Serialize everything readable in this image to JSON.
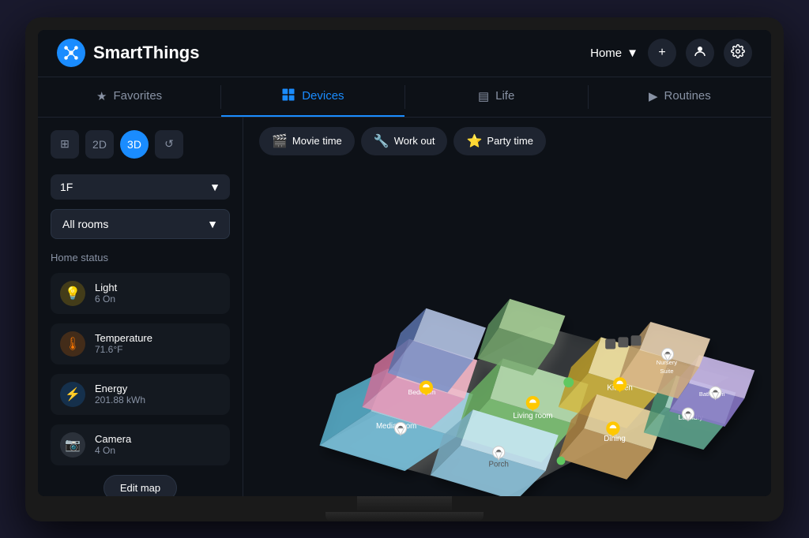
{
  "app": {
    "name": "SmartThings"
  },
  "header": {
    "home_label": "Home",
    "add_button": "+",
    "profile_icon": "person",
    "settings_icon": "gear"
  },
  "nav": {
    "tabs": [
      {
        "id": "favorites",
        "label": "Favorites",
        "icon": "★",
        "active": false
      },
      {
        "id": "devices",
        "label": "Devices",
        "icon": "▦",
        "active": true
      },
      {
        "id": "life",
        "label": "Life",
        "icon": "▤",
        "active": false
      },
      {
        "id": "routines",
        "label": "Routines",
        "icon": "▶",
        "active": false
      }
    ]
  },
  "sidebar": {
    "view_buttons": [
      {
        "id": "grid",
        "label": "⊞",
        "active": false
      },
      {
        "id": "2d",
        "label": "2D",
        "active": false
      },
      {
        "id": "3d",
        "label": "3D",
        "active": true
      },
      {
        "id": "reset",
        "label": "↺",
        "active": false
      }
    ],
    "floor_selector": {
      "label": "1F",
      "icon": "▼"
    },
    "room_selector": {
      "label": "All rooms",
      "icon": "▼"
    },
    "home_status_title": "Home status",
    "status_items": [
      {
        "id": "light",
        "icon": "💡",
        "type": "yellow",
        "label": "Light",
        "value": "6 On"
      },
      {
        "id": "temperature",
        "icon": "🌡",
        "type": "orange",
        "label": "Temperature",
        "value": "71.6°F"
      },
      {
        "id": "energy",
        "icon": "⚡",
        "type": "blue",
        "label": "Energy",
        "value": "201.88 kWh"
      },
      {
        "id": "camera",
        "icon": "📷",
        "type": "gray",
        "label": "Camera",
        "value": "4 On"
      }
    ],
    "edit_map_button": "Edit map"
  },
  "scenes": [
    {
      "id": "movie",
      "icon": "🎬",
      "label": "Movie time"
    },
    {
      "id": "workout",
      "icon": "🔧",
      "label": "Work out"
    },
    {
      "id": "party",
      "icon": "⭐",
      "label": "Party time"
    }
  ],
  "map": {
    "rooms": [
      {
        "label": "Media room",
        "color": "#a8d8ea"
      },
      {
        "label": "Living room",
        "color": "#b8e0b0"
      },
      {
        "label": "Bedroom",
        "color": "#f4b8c8"
      },
      {
        "label": "Kitchen",
        "color": "#f5e6a3"
      },
      {
        "label": "Porch",
        "color": "#d4e8f0"
      },
      {
        "label": "Dining",
        "color": "#e8d4a0"
      },
      {
        "label": "Laundry",
        "color": "#c8e0d8"
      },
      {
        "label": "Bathroom",
        "color": "#d0c8e8"
      },
      {
        "label": "Nursery Suite",
        "color": "#e8d8c8"
      }
    ]
  },
  "colors": {
    "bg": "#0d1117",
    "sidebar_bg": "#141920",
    "accent": "#1a8cff",
    "text_primary": "#ffffff",
    "text_secondary": "#8892a4",
    "border": "#1e2430"
  }
}
